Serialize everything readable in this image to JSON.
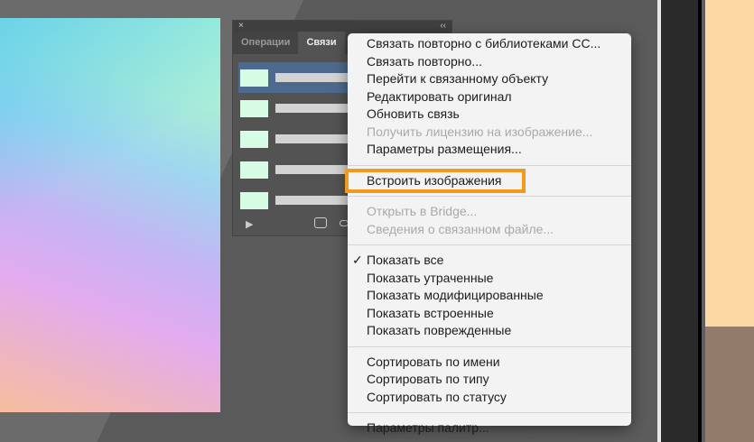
{
  "panel": {
    "close": "×",
    "collapse": "‹‹",
    "tabs": [
      "Операции",
      "Связи"
    ],
    "rows": 5,
    "play": "▶"
  },
  "menu": {
    "groups": [
      [
        {
          "label": "Связать повторно с библиотеками CC...",
          "enabled": true
        },
        {
          "label": "Связать повторно...",
          "enabled": true
        },
        {
          "label": "Перейти к связанному объекту",
          "enabled": true
        },
        {
          "label": "Редактировать оригинал",
          "enabled": true
        },
        {
          "label": "Обновить связь",
          "enabled": true
        },
        {
          "label": "Получить лицензию на изображение...",
          "enabled": false
        },
        {
          "label": "Параметры размещения...",
          "enabled": true
        }
      ],
      [
        {
          "label": "Встроить изображения",
          "enabled": true,
          "highlighted": true
        }
      ],
      [
        {
          "label": "Открыть в Bridge...",
          "enabled": false
        },
        {
          "label": "Сведения о связанном файле...",
          "enabled": false
        }
      ],
      [
        {
          "label": "Показать все",
          "enabled": true,
          "checked": true
        },
        {
          "label": "Показать утраченные",
          "enabled": true
        },
        {
          "label": "Показать модифицированные",
          "enabled": true
        },
        {
          "label": "Показать встроенные",
          "enabled": true
        },
        {
          "label": "Показать поврежденные",
          "enabled": true
        }
      ],
      [
        {
          "label": "Сортировать по имени",
          "enabled": true
        },
        {
          "label": "Сортировать по типу",
          "enabled": true
        },
        {
          "label": "Сортировать по статусу",
          "enabled": true
        }
      ],
      [
        {
          "label": "Параметры палитр...",
          "enabled": true
        }
      ]
    ],
    "check_mark": "✓",
    "highlight_color": "#f29a1e"
  }
}
